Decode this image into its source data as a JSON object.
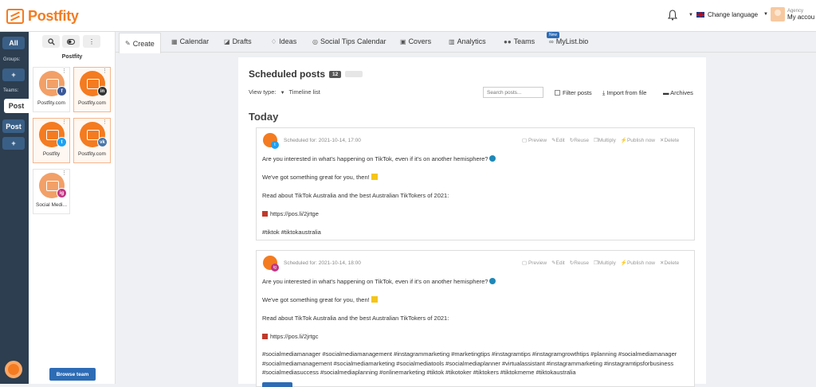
{
  "brand": {
    "name": "Postfity",
    "color": "#f47b20"
  },
  "topbar": {
    "language_label": "Change language",
    "account": {
      "role": "Agency",
      "name": "My accou"
    }
  },
  "leftbar": {
    "all_label": "All",
    "groups_label": "Groups:",
    "add_group": "+",
    "teams_label": "Teams:",
    "team_active": "Post",
    "team_other": "Post",
    "add_team": "+"
  },
  "profiles": {
    "title": "Postfity",
    "items": [
      {
        "name": "Postfity.com",
        "network": "facebook",
        "net_label": "f",
        "selected": false
      },
      {
        "name": "Postfity.com",
        "network": "linkedin",
        "net_label": "in",
        "selected": true
      },
      {
        "name": "Postfity",
        "network": "twitter",
        "net_label": "t",
        "selected": true
      },
      {
        "name": "Postfity.com",
        "network": "vk",
        "net_label": "vk",
        "selected": true
      },
      {
        "name": "Social Medi...",
        "network": "instagram",
        "net_label": "ig",
        "selected": false
      }
    ],
    "browse_button": "Browse team"
  },
  "tabs": [
    {
      "label": "Create",
      "icon": "edit-icon"
    },
    {
      "label": "Calendar",
      "icon": "calendar-icon"
    },
    {
      "label": "Drafts",
      "icon": "drafts-icon"
    },
    {
      "label": "Ideas",
      "icon": "lightbulb-icon"
    },
    {
      "label": "Social Tips Calendar",
      "icon": "tips-icon"
    },
    {
      "label": "Covers",
      "icon": "image-icon"
    },
    {
      "label": "Analytics",
      "icon": "chart-icon"
    },
    {
      "label": "Teams",
      "icon": "users-icon"
    },
    {
      "label": "MyList.bio",
      "icon": "link-icon",
      "badge": "New"
    }
  ],
  "main": {
    "title": "Scheduled posts",
    "count": "12",
    "view_type_label": "View type:",
    "view_type_value": "Timeline list",
    "search_placeholder": "Search posts...",
    "filter_label": "Filter posts",
    "import_label": "Import from file",
    "archives_label": "Archives",
    "day_heading": "Today",
    "actions": [
      "Preview",
      "Edit",
      "Reuse",
      "Multiply",
      "Publish now",
      "Delete"
    ]
  },
  "posts": [
    {
      "network": "twitter",
      "scheduled": "Scheduled for: 2021-10-14, 17:00",
      "line1": "Are you interested in what's happening on TikTok, even if it's on another hemisphere?",
      "line2": "We've got something great for you, then!",
      "line3": "Read about TikTok Australia and the best Australian TikTokers of 2021:",
      "link": "https://pos.li/2jrtge",
      "tags": "#tiktok #tiktokaustralia"
    },
    {
      "network": "instagram",
      "scheduled": "Scheduled for: 2021-10-14, 18:00",
      "line1": "Are you interested in what's happening on TikTok, even if it's on another hemisphere?",
      "line2": "We've got something great for you, then!",
      "line3": "Read about TikTok Australia and the best Australian TikTokers of 2021:",
      "link": "https://pos.li/2jrtgc",
      "tags": "#socialmediamanager #socialmediamanagement #instagrammarketing #marketingtips #instagramtips #instagramgrowthtips #planning #socialmediamanager #socialmediamanagement #socialmediamarketing #socialmediatools #socialmediaplanner #virtualassistant #instagrammarketing #instagramtipsforbusiness #socialmediasuccess #socialmediaplanning #onlinemarketing #tiktok #tikotoker #tiktokers #tiktokmeme #tiktokaustralia"
    }
  ],
  "colors": {
    "facebook": "#3b5998",
    "linkedin": "#333333",
    "twitter": "#1da1f2",
    "vk": "#4a76a8",
    "instagram": "#c13584",
    "primary": "#2d6cb5"
  }
}
